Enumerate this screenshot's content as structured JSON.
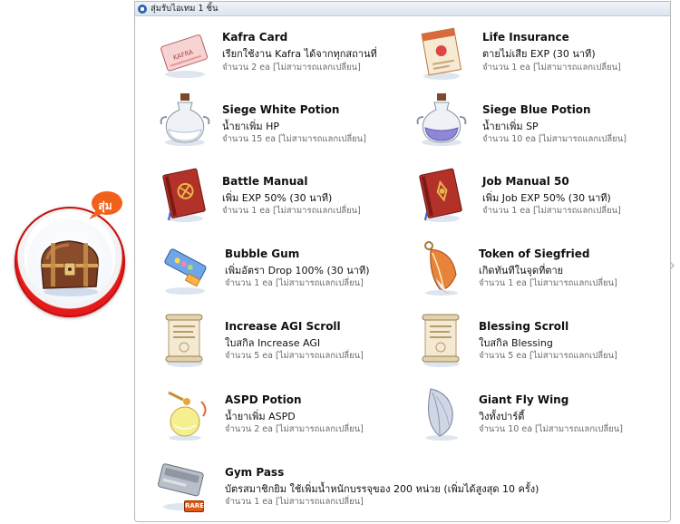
{
  "header": {
    "title": "สุ่มรับไอเทม 1 ชิ้น",
    "icon": "info-icon"
  },
  "badge": {
    "label": "สุ่ม",
    "icon": "treasure-chest-icon"
  },
  "items": [
    {
      "name": "Kafra Card",
      "desc": "เรียกใช้งาน Kafra ได้จากทุกสถานที่",
      "qty": "จำนวน 2 ea [ไม่สามารถแลกเปลี่ยน]",
      "icon": "kafra-card-icon"
    },
    {
      "name": "Life Insurance",
      "desc": "ตายไม่เสีย EXP (30 นาที)",
      "qty": "จำนวน 1 ea [ไม่สามารถแลกเปลี่ยน]",
      "icon": "life-insurance-icon"
    },
    {
      "name": "Siege White Potion",
      "desc": "น้ำยาเพิ่ม HP",
      "qty": "จำนวน 15 ea [ไม่สามารถแลกเปลี่ยน]",
      "icon": "white-potion-icon"
    },
    {
      "name": "Siege Blue Potion",
      "desc": "น้ำยาเพิ่ม SP",
      "qty": "จำนวน 10 ea [ไม่สามารถแลกเปลี่ยน]",
      "icon": "blue-potion-icon"
    },
    {
      "name": "Battle Manual",
      "desc": "เพิ่ม EXP 50% (30 นาที)",
      "qty": "จำนวน 1 ea [ไม่สามารถแลกเปลี่ยน]",
      "icon": "battle-manual-icon"
    },
    {
      "name": "Job Manual 50",
      "desc": "เพิ่ม Job EXP 50% (30 นาที)",
      "qty": "จำนวน 1 ea [ไม่สามารถแลกเปลี่ยน]",
      "icon": "job-manual-icon"
    },
    {
      "name": "Bubble Gum",
      "desc": "เพิ่มอัตรา Drop 100% (30 นาที)",
      "qty": "จำนวน 1 ea [ไม่สามารถแลกเปลี่ยน]",
      "icon": "bubble-gum-icon"
    },
    {
      "name": "Token of Siegfried",
      "desc": "เกิดทันทีในจุดที่ตาย",
      "qty": "จำนวน 1 ea [ไม่สามารถแลกเปลี่ยน]",
      "icon": "feather-token-icon"
    },
    {
      "name": "Increase AGI Scroll",
      "desc": "ใบสกิล Increase AGI",
      "qty": "จำนวน 5 ea [ไม่สามารถแลกเปลี่ยน]",
      "icon": "scroll-icon"
    },
    {
      "name": "Blessing Scroll",
      "desc": "ใบสกิล Blessing",
      "qty": "จำนวน 5 ea [ไม่สามารถแลกเปลี่ยน]",
      "icon": "scroll-icon"
    },
    {
      "name": "ASPD Potion",
      "desc": "น้ำยาเพิ่ม ASPD",
      "qty": "จำนวน 2 ea [ไม่สามารถแลกเปลี่ยน]",
      "icon": "aspd-potion-icon"
    },
    {
      "name": "Giant Fly Wing",
      "desc": "วิงทั้งปาร์ตี้",
      "qty": "จำนวน 10 ea [ไม่สามารถแลกเปลี่ยน]",
      "icon": "fly-wing-icon"
    },
    {
      "name": "Gym Pass",
      "desc": "บัตรสมาชิกยิม ใช้เพิ่มน้ำหนักบรรจุของ 200 หน่วย (เพิ่มได้สูงสุด 10 ครั้ง)",
      "qty": "จำนวน 1 ea [ไม่สามารถแลกเปลี่ยน]",
      "icon": "gym-pass-icon",
      "tag": "RARE"
    }
  ]
}
